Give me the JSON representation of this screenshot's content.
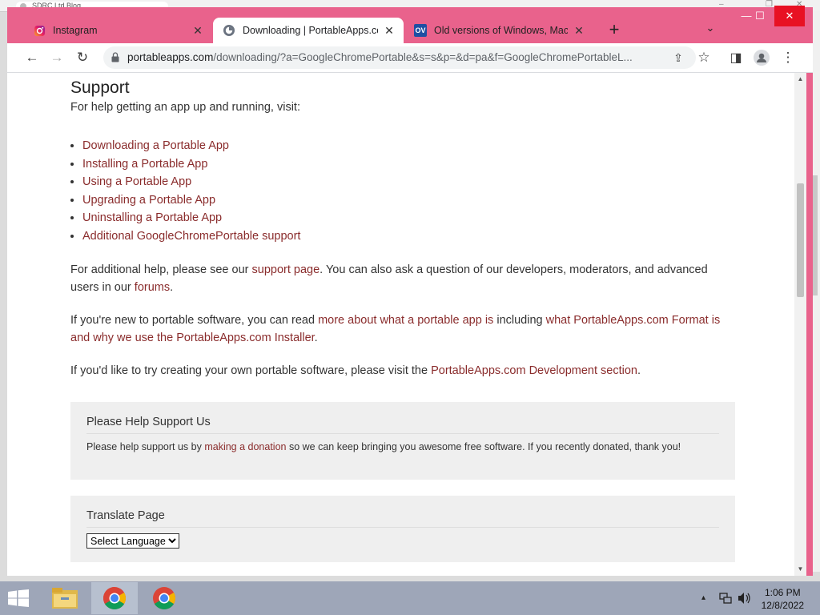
{
  "background_window": {
    "tab_title": "SDRC Ltd Blog ...",
    "min": "–",
    "max": "❐",
    "close": "✕"
  },
  "tabs": [
    {
      "title": "Instagram",
      "favicon": "instagram-icon",
      "close": "✕"
    },
    {
      "title": "Downloading | PortableApps.com",
      "favicon": "portableapps-icon",
      "close": "✕",
      "active": true
    },
    {
      "title": "Old versions of Windows, Mac and Linux",
      "favicon": "ov-icon",
      "favicon_text": "OV",
      "close": "✕"
    }
  ],
  "tabstrip": {
    "new_tab": "+",
    "search_tabs": "⌄"
  },
  "window_controls": {
    "minimize": "—",
    "maximize": "☐",
    "close": "✕"
  },
  "toolbar": {
    "back": "←",
    "forward": "→",
    "reload": "↻",
    "url_host": "portableapps.com",
    "url_path": "/downloading/?a=GoogleChromePortable&s=s&p=&d=pa&f=GoogleChromePortableL...",
    "share": "⇪",
    "bookmark": "☆",
    "sidepanel": "◨",
    "profile": "●",
    "menu": "⋮"
  },
  "page": {
    "heading": "Support",
    "intro": "For help getting an app up and running, visit:",
    "links": [
      "Downloading a Portable App",
      "Installing a Portable App",
      "Using a Portable App",
      "Upgrading a Portable App",
      "Uninstalling a Portable App",
      "Additional GoogleChromePortable support"
    ],
    "p1": {
      "a": "For additional help, please see our ",
      "link1": "support page",
      "b": ". You can also ask a question of our developers, moderators, and advanced users in our ",
      "link2": "forums",
      "c": "."
    },
    "p2": {
      "a": "If you're new to portable software, you can read ",
      "link1": "more about what a portable app is",
      "b": " including ",
      "link2": "what PortableApps.com Format is and why we use the PortableApps.com Installer",
      "c": "."
    },
    "p3": {
      "a": "If you'd like to try creating your own portable software, please visit the ",
      "link1": "PortableApps.com Development section",
      "c": "."
    },
    "support_box": {
      "heading": "Please Help Support Us",
      "a": "Please help support us by ",
      "link": "making a donation",
      "b": " so we can keep bringing you awesome free software. If you recently donated, thank you!"
    },
    "translate_box": {
      "heading": "Translate Page",
      "select_value": "Select Language"
    }
  },
  "taskbar": {
    "time": "1:06 PM",
    "date": "12/8/2022",
    "tray_chevron": "▴"
  }
}
